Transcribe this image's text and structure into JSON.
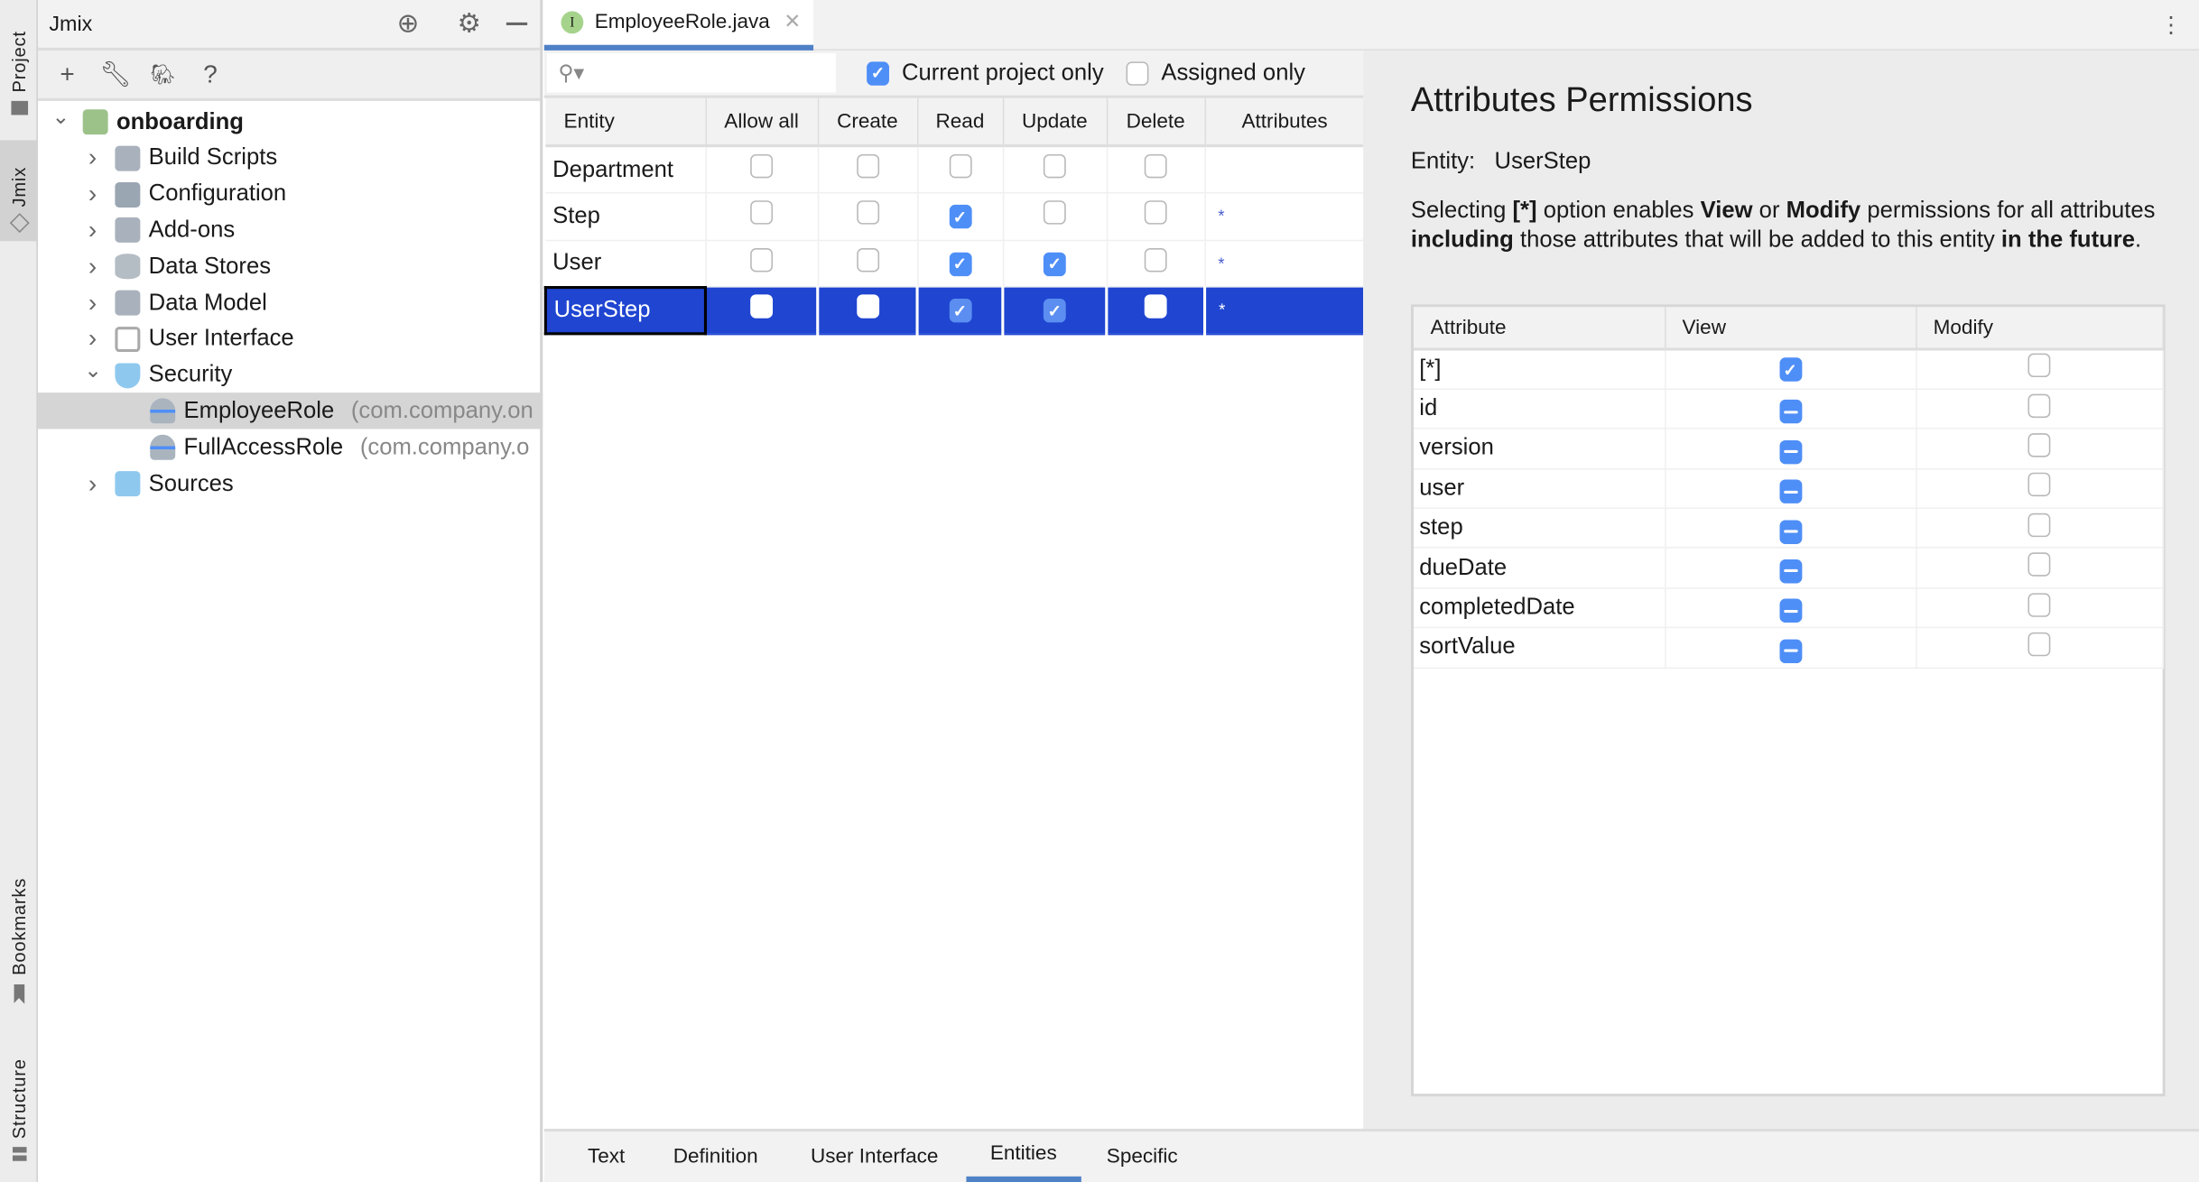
{
  "side_stripe": {
    "top": [
      "Project",
      "Jmix"
    ],
    "bottom": [
      "Bookmarks",
      "Structure"
    ]
  },
  "project_panel": {
    "title": "Jmix",
    "tree": [
      {
        "label": "onboarding",
        "bold": true,
        "icon": "jmix-project-icon",
        "expanded": true,
        "level": 0
      },
      {
        "label": "Build Scripts",
        "icon": "gradle-elephant-icon",
        "level": 1
      },
      {
        "label": "Configuration",
        "icon": "config-gear-icon",
        "level": 1
      },
      {
        "label": "Add-ons",
        "icon": "puzzle-icon",
        "level": 1
      },
      {
        "label": "Data Stores",
        "icon": "database-icon",
        "level": 1
      },
      {
        "label": "Data Model",
        "icon": "data-model-icon",
        "level": 1
      },
      {
        "label": "User Interface",
        "icon": "window-icon",
        "level": 1
      },
      {
        "label": "Security",
        "icon": "shield-icon",
        "expanded": true,
        "level": 1
      },
      {
        "label": "EmployeeRole",
        "pkg": "(com.company.on",
        "icon": "role-icon",
        "level": 2,
        "selected": true
      },
      {
        "label": "FullAccessRole",
        "pkg": "(com.company.o",
        "icon": "role-icon",
        "level": 2
      },
      {
        "label": "Sources",
        "icon": "folder-icon",
        "level": 1
      }
    ]
  },
  "editor": {
    "tab": {
      "label": "EmployeeRole.java",
      "badge": "I"
    },
    "filters": {
      "current_project_only": {
        "label": "Current project only",
        "checked": true
      },
      "assigned_only": {
        "label": "Assigned only",
        "checked": false
      }
    },
    "columns": [
      "Entity",
      "Allow all",
      "Create",
      "Read",
      "Update",
      "Delete",
      "Attributes"
    ],
    "rows": [
      {
        "entity": "Department",
        "perms": [
          false,
          false,
          false,
          false,
          false
        ],
        "attributes": ""
      },
      {
        "entity": "Step",
        "perms": [
          false,
          false,
          true,
          false,
          false
        ],
        "attributes": "*"
      },
      {
        "entity": "User",
        "perms": [
          false,
          false,
          true,
          true,
          false
        ],
        "attributes": "*"
      },
      {
        "entity": "UserStep",
        "perms": [
          false,
          false,
          true,
          true,
          false
        ],
        "attributes": "*",
        "selected": true
      }
    ],
    "bottom_tabs": [
      "Text",
      "Definition",
      "User Interface",
      "Entities",
      "Specific"
    ],
    "active_bottom_tab": "Entities"
  },
  "attributes_panel": {
    "title": "Attributes Permissions",
    "entity_label": "Entity:",
    "entity_value": "UserStep",
    "desc": {
      "p1": "Selecting ",
      "b1": "[*]",
      "p2": " option enables ",
      "b2": "View",
      "p3": " or ",
      "b3": "Modify",
      "p4": " permissions for all attributes ",
      "b4": "including",
      "p5": " those attributes that will be added to this entity ",
      "b5": "in the future",
      "p6": "."
    },
    "columns": [
      "Attribute",
      "View",
      "Modify"
    ],
    "rows": [
      {
        "name": "[*]",
        "view": "checked",
        "modify": false
      },
      {
        "name": "id",
        "view": "mixed",
        "modify": false
      },
      {
        "name": "version",
        "view": "mixed",
        "modify": false
      },
      {
        "name": "user",
        "view": "mixed",
        "modify": false
      },
      {
        "name": "step",
        "view": "mixed",
        "modify": false
      },
      {
        "name": "dueDate",
        "view": "mixed",
        "modify": false
      },
      {
        "name": "completedDate",
        "view": "mixed",
        "modify": false
      },
      {
        "name": "sortValue",
        "view": "mixed",
        "modify": false
      }
    ]
  },
  "colors": {
    "accent": "#4e8ef7",
    "selection": "#1f45d1",
    "tab_underline": "#4f81c7"
  }
}
